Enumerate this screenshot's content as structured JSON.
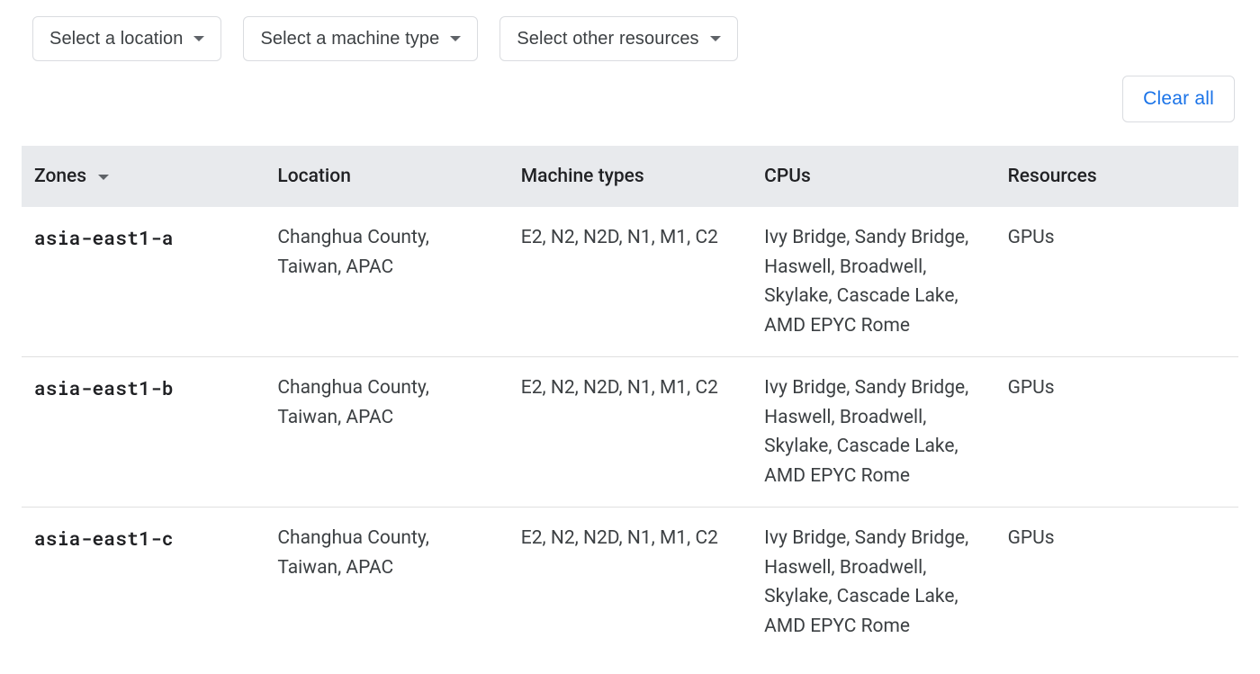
{
  "filters": {
    "location_label": "Select a location",
    "machine_type_label": "Select a machine type",
    "other_resources_label": "Select other resources"
  },
  "actions": {
    "clear_all_label": "Clear all"
  },
  "columns": {
    "zones": "Zones",
    "location": "Location",
    "machine_types": "Machine types",
    "cpus": "CPUs",
    "resources": "Resources"
  },
  "rows": [
    {
      "zone": "asia-east1-a",
      "location": "Changhua County, Taiwan, APAC",
      "machine_types": "E2, N2, N2D, N1, M1, C2",
      "cpus": "Ivy Bridge, Sandy Bridge, Haswell, Broadwell, Skylake, Cascade Lake, AMD EPYC Rome",
      "resources": "GPUs"
    },
    {
      "zone": "asia-east1-b",
      "location": "Changhua County, Taiwan, APAC",
      "machine_types": "E2, N2, N2D, N1, M1, C2",
      "cpus": "Ivy Bridge, Sandy Bridge, Haswell, Broadwell, Skylake, Cascade Lake, AMD EPYC Rome",
      "resources": "GPUs"
    },
    {
      "zone": "asia-east1-c",
      "location": "Changhua County, Taiwan, APAC",
      "machine_types": "E2, N2, N2D, N1, M1, C2",
      "cpus": "Ivy Bridge, Sandy Bridge, Haswell, Broadwell, Skylake, Cascade Lake, AMD EPYC Rome",
      "resources": "GPUs"
    }
  ]
}
